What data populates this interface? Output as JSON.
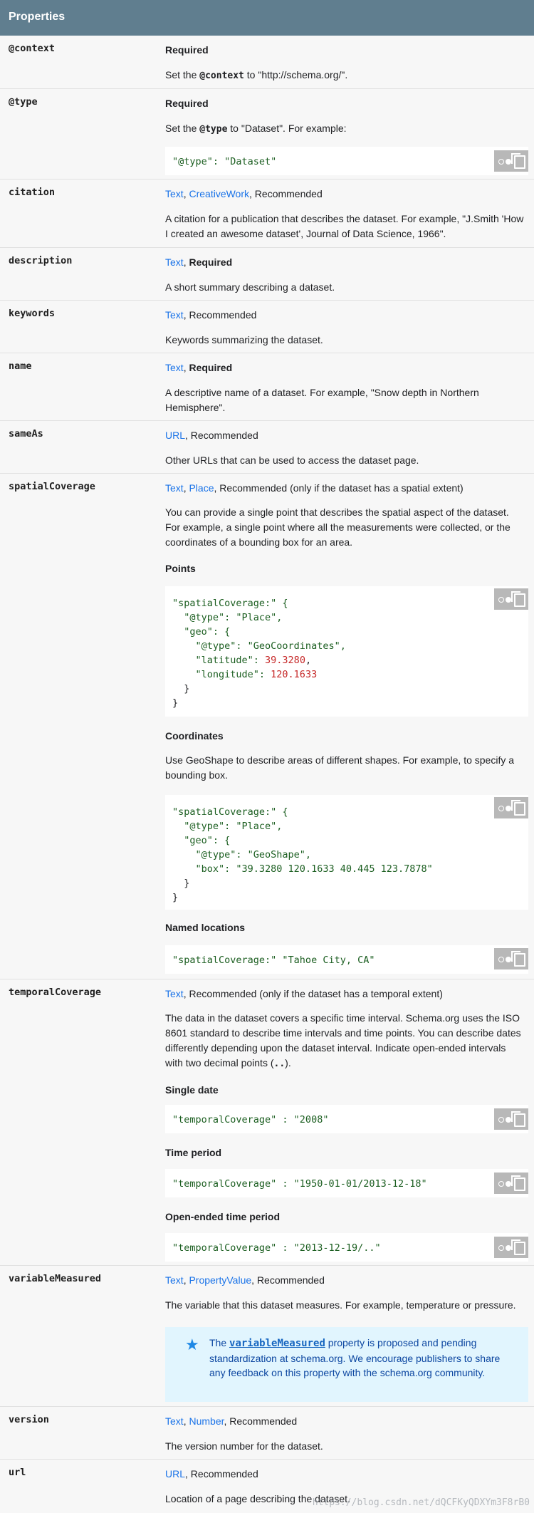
{
  "header": {
    "title": "Properties"
  },
  "labels": {
    "recommended": "Recommended",
    "required": "Required",
    "comma": ", "
  },
  "rows": {
    "context": {
      "name": "@context",
      "type": "Required",
      "desc_pre": "Set the ",
      "desc_code": "@context",
      "desc_post": " to \"http://schema.org/\"."
    },
    "type": {
      "name": "@type",
      "type": "Required",
      "desc_pre": "Set the ",
      "desc_code": "@type",
      "desc_post": " to \"Dataset\". For example:",
      "code": "\"@type\": \"Dataset\""
    },
    "citation": {
      "name": "citation",
      "types": [
        "Text",
        "CreativeWork"
      ],
      "desc": "A citation for a publication that describes the dataset. For example, \"J.Smith 'How I created an awesome dataset', Journal of Data Science, 1966\"."
    },
    "description": {
      "name": "description",
      "types": [
        "Text"
      ],
      "desc": "A short summary describing a dataset."
    },
    "keywords": {
      "name": "keywords",
      "types": [
        "Text"
      ],
      "desc": "Keywords summarizing the dataset."
    },
    "name": {
      "name": "name",
      "types": [
        "Text"
      ],
      "desc": "A descriptive name of a dataset. For example, \"Snow depth in Northern Hemisphere\"."
    },
    "sameAs": {
      "name": "sameAs",
      "types": [
        "URL"
      ],
      "desc": "Other URLs that can be used to access the dataset page."
    },
    "spatialCoverage": {
      "name": "spatialCoverage",
      "types": [
        "Text",
        "Place"
      ],
      "type_suffix": "Recommended (only if the dataset has a spatial extent)",
      "desc": "You can provide a single point that describes the spatial aspect of the dataset. For example, a single point where all the measurements were collected, or the coordinates of a bounding box for an area.",
      "points_title": "Points",
      "points_code": [
        "\"spatialCoverage:\" {",
        "  \"@type\": \"Place\",",
        "  \"geo\": {",
        "    \"@type\": \"GeoCoordinates\",",
        "    \"latitude\": ",
        "39.3280",
        ",",
        "    \"longitude\": ",
        "120.1633",
        "  }",
        "}"
      ],
      "coords_title": "Coordinates",
      "coords_desc": "Use GeoShape to describe areas of different shapes. For example, to specify a bounding box.",
      "coords_code": [
        "\"spatialCoverage:\" {",
        "  \"@type\": \"Place\",",
        "  \"geo\": {",
        "    \"@type\": \"GeoShape\",",
        "    \"box\": \"39.3280 120.1633 40.445 123.7878\"",
        "  }",
        "}"
      ],
      "named_title": "Named locations",
      "named_code": "\"spatialCoverage:\" \"Tahoe City, CA\""
    },
    "temporalCoverage": {
      "name": "temporalCoverage",
      "types": [
        "Text"
      ],
      "type_suffix": "Recommended (only if the dataset has a temporal extent)",
      "desc": "The data in the dataset covers a specific time interval. Schema.org uses the ISO 8601 standard to describe time intervals and time points. You can describe dates differently depending upon the dataset interval. Indicate open-ended intervals with two decimal points (",
      "desc_code": "..",
      "desc_post": ").",
      "single_title": "Single date",
      "single_code": "\"temporalCoverage\" : \"2008\"",
      "period_title": "Time period",
      "period_code": "\"temporalCoverage\" : \"1950-01-01/2013-12-18\"",
      "open_title": "Open-ended time period",
      "open_code": "\"temporalCoverage\" : \"2013-12-19/..\""
    },
    "variableMeasured": {
      "name": "variableMeasured",
      "types": [
        "Text",
        "PropertyValue"
      ],
      "desc": "The variable that this dataset measures. For example, temperature or pressure.",
      "note_pre": "The ",
      "note_code": "variableMeasured",
      "note_post": " property is proposed and pending standardization at schema.org. We encourage publishers to share any feedback on this property with the schema.org community."
    },
    "version": {
      "name": "version",
      "types": [
        "Text",
        "Number"
      ],
      "desc": "The version number for the dataset."
    },
    "url": {
      "name": "url",
      "types": [
        "URL"
      ],
      "desc": "Location of a page describing the dataset."
    }
  },
  "watermark": "https://blog.csdn.net/dQCFKyQDXYm3F8rB0"
}
